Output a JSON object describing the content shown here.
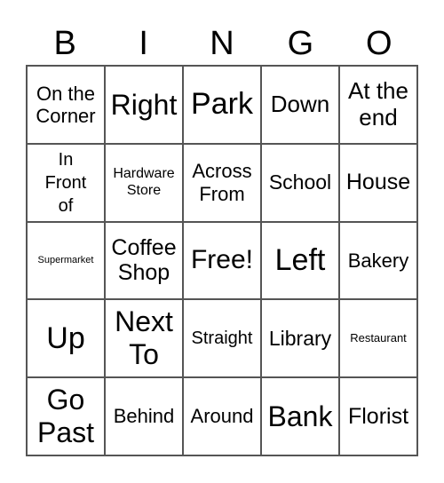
{
  "header": {
    "letters": [
      "B",
      "I",
      "N",
      "G",
      "O"
    ]
  },
  "grid": {
    "rows": [
      [
        "On the Corner",
        "Right",
        "Park",
        "Down",
        "At the end"
      ],
      [
        "In Front of",
        "Hardware Store",
        "Across From",
        "School",
        "House"
      ],
      [
        "Supermarket",
        "Coffee Shop",
        "Free!",
        "Left",
        "Bakery"
      ],
      [
        "Up",
        "Next To",
        "Straight",
        "Library",
        "Restaurant"
      ],
      [
        "Go Past",
        "Behind",
        "Around",
        "Bank",
        "Florist"
      ]
    ]
  }
}
